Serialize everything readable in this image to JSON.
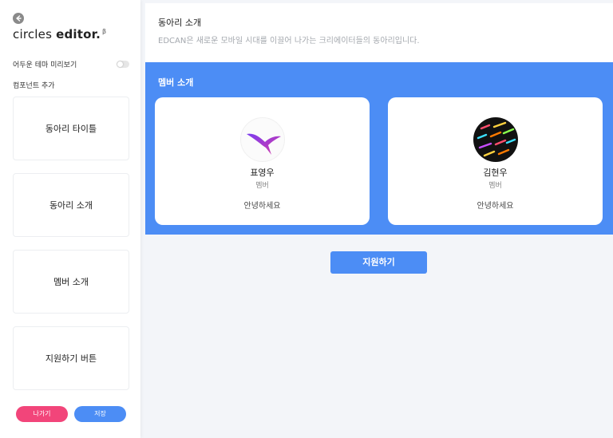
{
  "sidebar": {
    "brand_light": "circles",
    "brand_bold": "editor.",
    "brand_sup": "β",
    "dark_preview_label": "어두운 테마 미리보기",
    "add_component_label": "컴포넌트 추가",
    "components": [
      {
        "label": "동아리 타이틀"
      },
      {
        "label": "동아리 소개"
      },
      {
        "label": "멤버 소개"
      },
      {
        "label": "지원하기 버튼"
      }
    ],
    "exit_label": "나가기",
    "save_label": "저장"
  },
  "intro": {
    "title": "동아리 소개",
    "description": "EDCAN은 새로운 모바일 시대를 이끌어 나가는 크리에이터들의 동아리입니다."
  },
  "members": {
    "title": "멤버 소개",
    "list": [
      {
        "name": "표영우",
        "role": "멤버",
        "greeting": "안녕하세요"
      },
      {
        "name": "김현우",
        "role": "멤버",
        "greeting": "안녕하세요"
      }
    ]
  },
  "apply": {
    "label": "지원하기"
  },
  "colors": {
    "accent": "#4c8df5",
    "exit": "#f2457a",
    "background": "#f3f5f9"
  },
  "icons": {
    "back": "back-arrow-icon",
    "toggle": "toggle-switch-icon"
  }
}
